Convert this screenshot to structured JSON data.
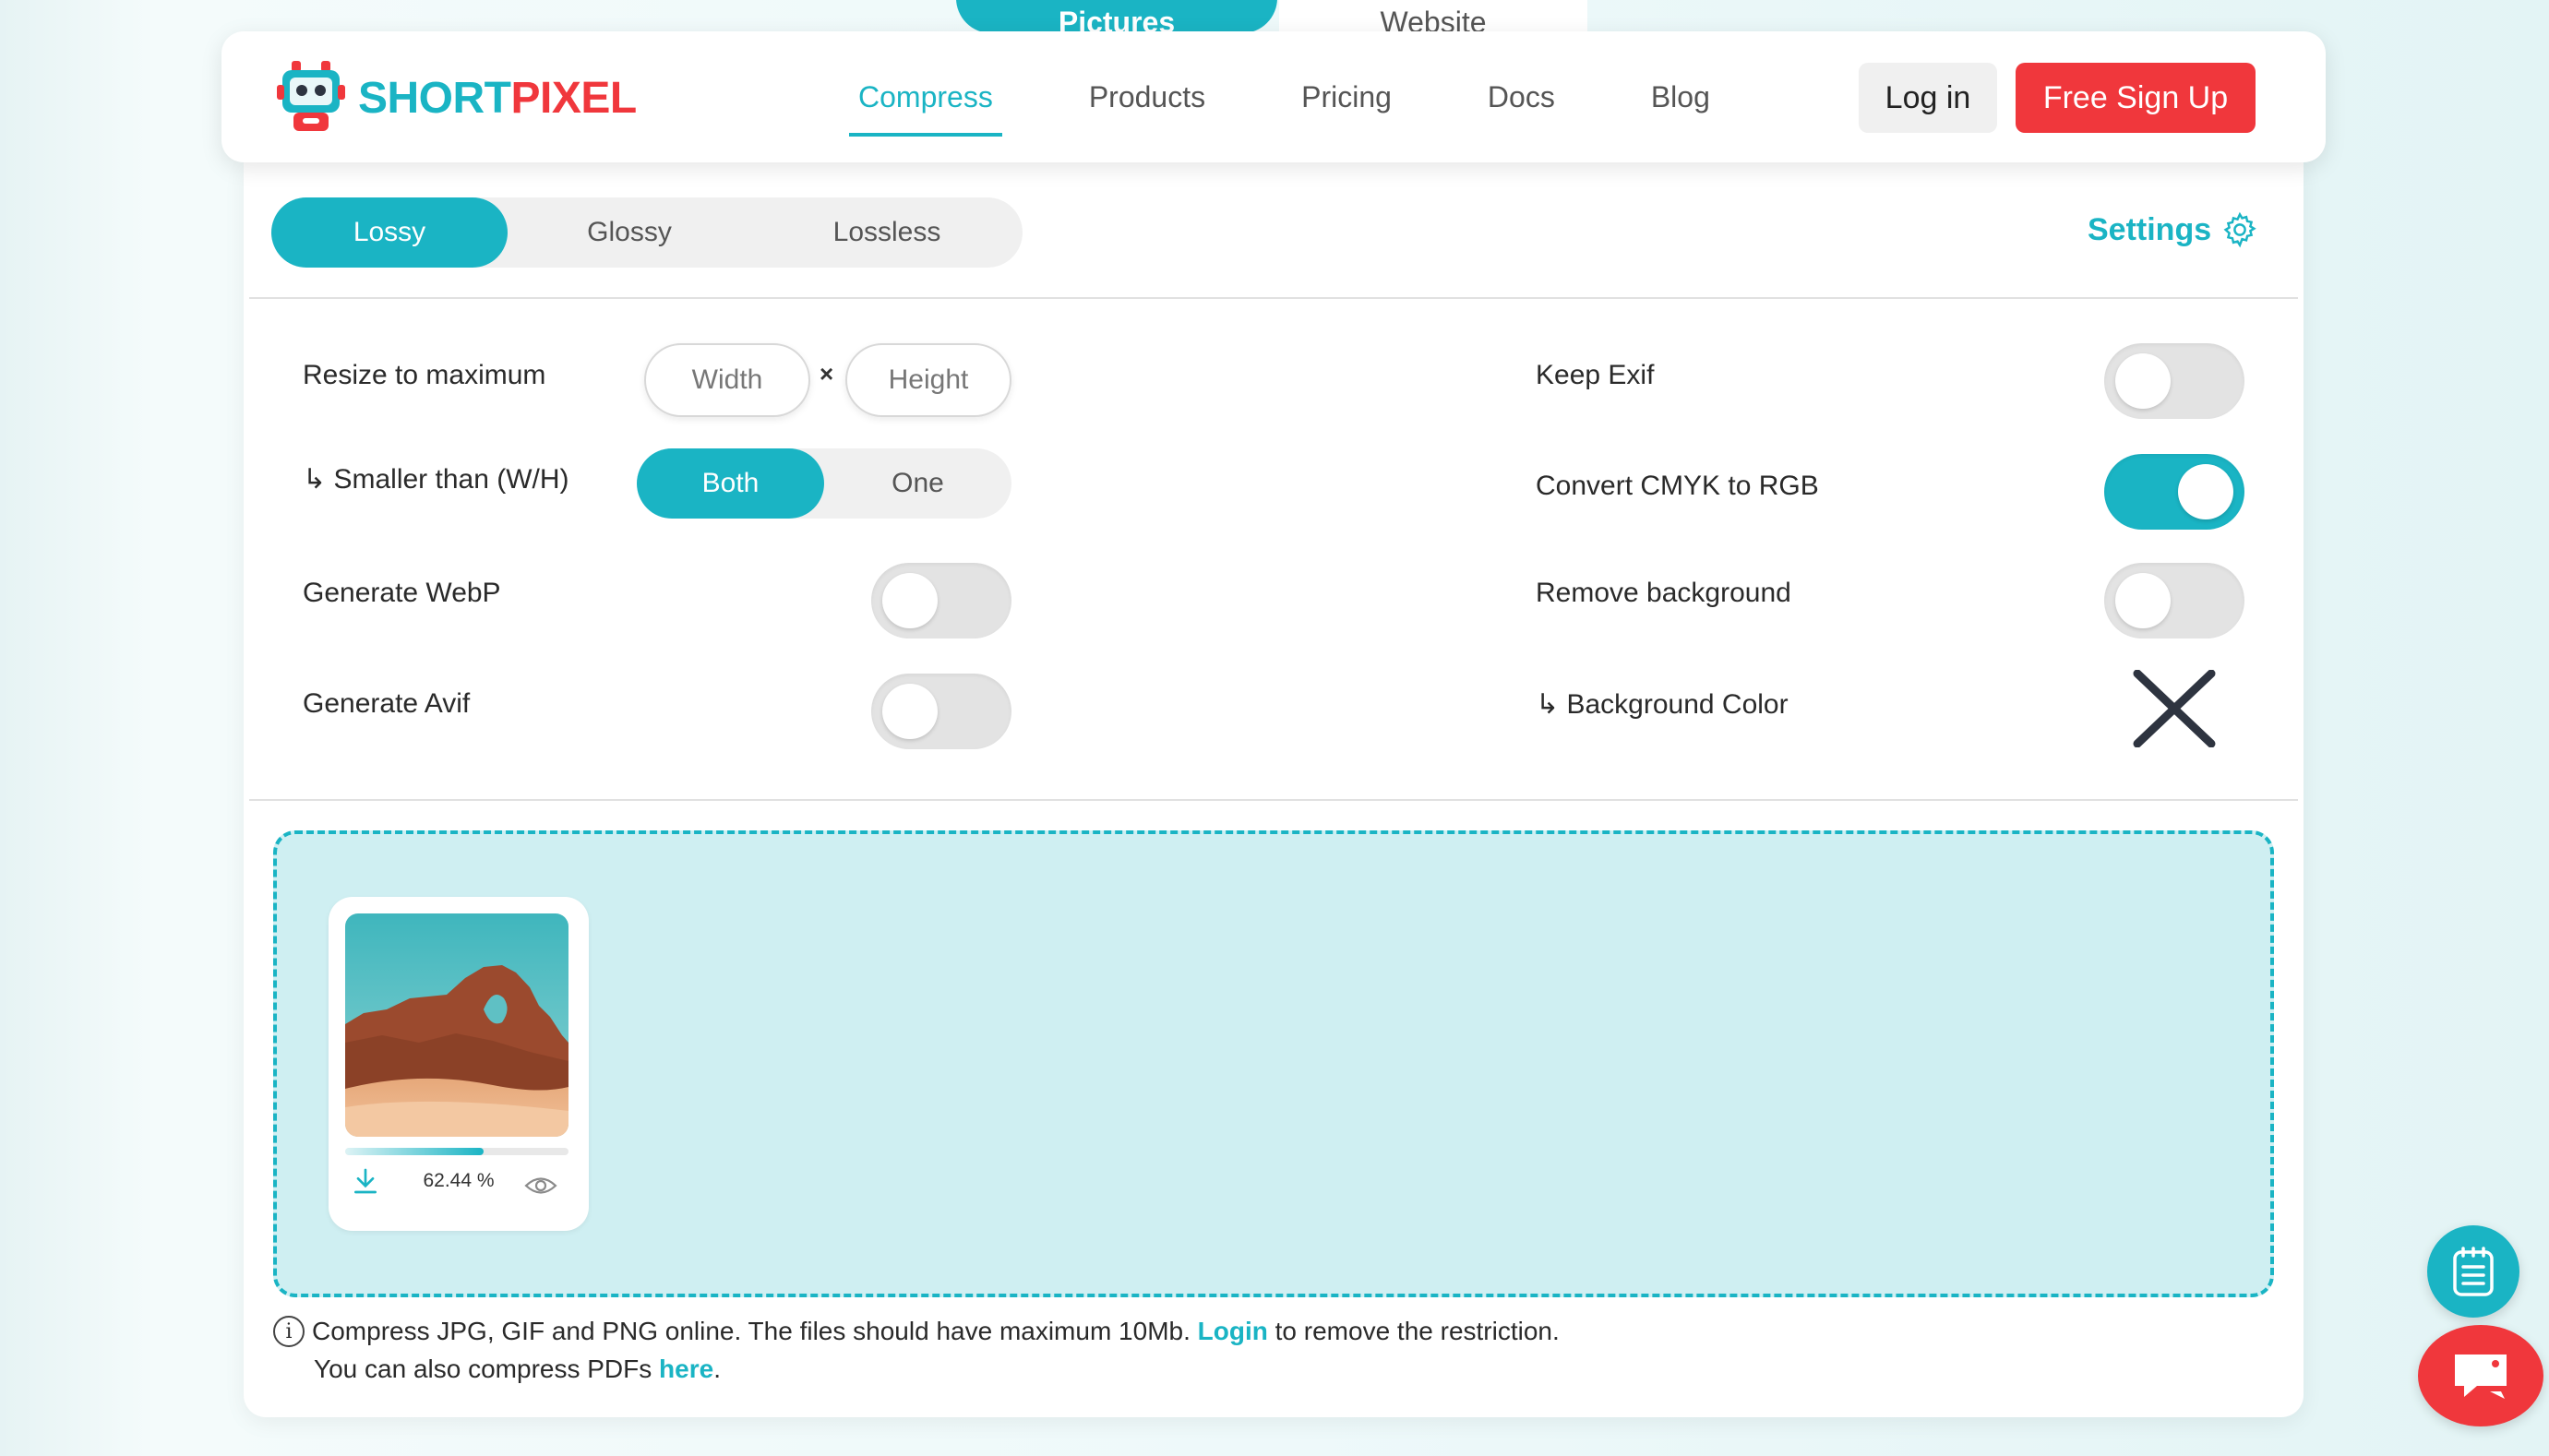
{
  "view_tabs": {
    "pictures": "Pictures",
    "website": "Website"
  },
  "brand": {
    "short": "SHORT",
    "pixel": "PIXEL",
    "teal": "#1ab4c4",
    "red": "#f0373c"
  },
  "nav": {
    "items": [
      "Compress",
      "Products",
      "Pricing",
      "Docs",
      "Blog"
    ],
    "active": "Compress",
    "login": "Log in",
    "signup": "Free Sign Up"
  },
  "compression": {
    "modes": [
      "Lossy",
      "Glossy",
      "Lossless"
    ],
    "active_mode": "Lossy",
    "settings_label": "Settings"
  },
  "options": {
    "resize_label": "Resize to maximum",
    "width_placeholder": "Width",
    "times": "×",
    "height_placeholder": "Height",
    "smaller_label": "↳ Smaller than (W/H)",
    "smaller_options": [
      "Both",
      "One"
    ],
    "smaller_active": "Both",
    "webp_label": "Generate WebP",
    "webp_on": false,
    "avif_label": "Generate Avif",
    "avif_on": false,
    "exif_label": "Keep Exif",
    "exif_on": false,
    "cmyk_label": "Convert CMYK to RGB",
    "cmyk_on": true,
    "removebg_label": "Remove background",
    "removebg_on": false,
    "bgcolor_label": "↳ Background Color"
  },
  "upload": {
    "files": [
      {
        "percent_label": "62.44 %",
        "progress": 0.62
      }
    ]
  },
  "info": {
    "line1_pre": "Compress JPG, GIF and PNG online. The files should have maximum 10Mb.",
    "line1_link": "Login",
    "line1_post": "to remove the restriction.",
    "line2_pre": "You can also compress PDFs",
    "line2_link": "here",
    "line2_post": "."
  },
  "icons": [
    "shortpixel-robot-icon",
    "gear-icon",
    "close-x-icon",
    "download-icon",
    "eye-icon",
    "info-icon",
    "notes-icon",
    "chat-icon"
  ]
}
